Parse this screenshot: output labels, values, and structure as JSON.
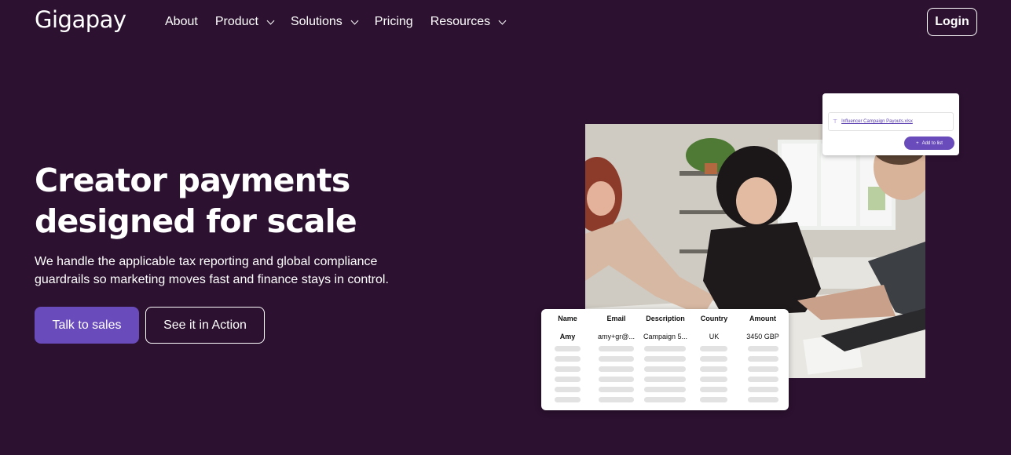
{
  "brand": {
    "logo": "Gigapay"
  },
  "nav": {
    "items": [
      {
        "label": "About",
        "dropdown": false
      },
      {
        "label": "Product",
        "dropdown": true
      },
      {
        "label": "Solutions",
        "dropdown": true
      },
      {
        "label": "Pricing",
        "dropdown": false
      },
      {
        "label": "Resources",
        "dropdown": true
      }
    ],
    "login_label": "Login"
  },
  "hero": {
    "headline_line1": "Creator payments",
    "headline_line2": "designed for scale",
    "sub_line1": "We handle the applicable tax reporting and global compliance",
    "sub_line2": "guardrails so marketing moves fast and finance stays in control.",
    "primary_cta": "Talk to sales",
    "secondary_cta": "See it in Action"
  },
  "upload_card": {
    "file_name": "Influencer Campaign Payouts.xlsx",
    "add_button": "Add to list"
  },
  "payout_table": {
    "columns": [
      "Name",
      "Email",
      "Description",
      "Country",
      "Amount"
    ],
    "first_row": [
      "Amy",
      "amy+gr@...",
      "Campaign 5...",
      "UK",
      "3450 GBP"
    ]
  },
  "colors": {
    "background": "#2c1130",
    "accent": "#6a4bbb"
  }
}
